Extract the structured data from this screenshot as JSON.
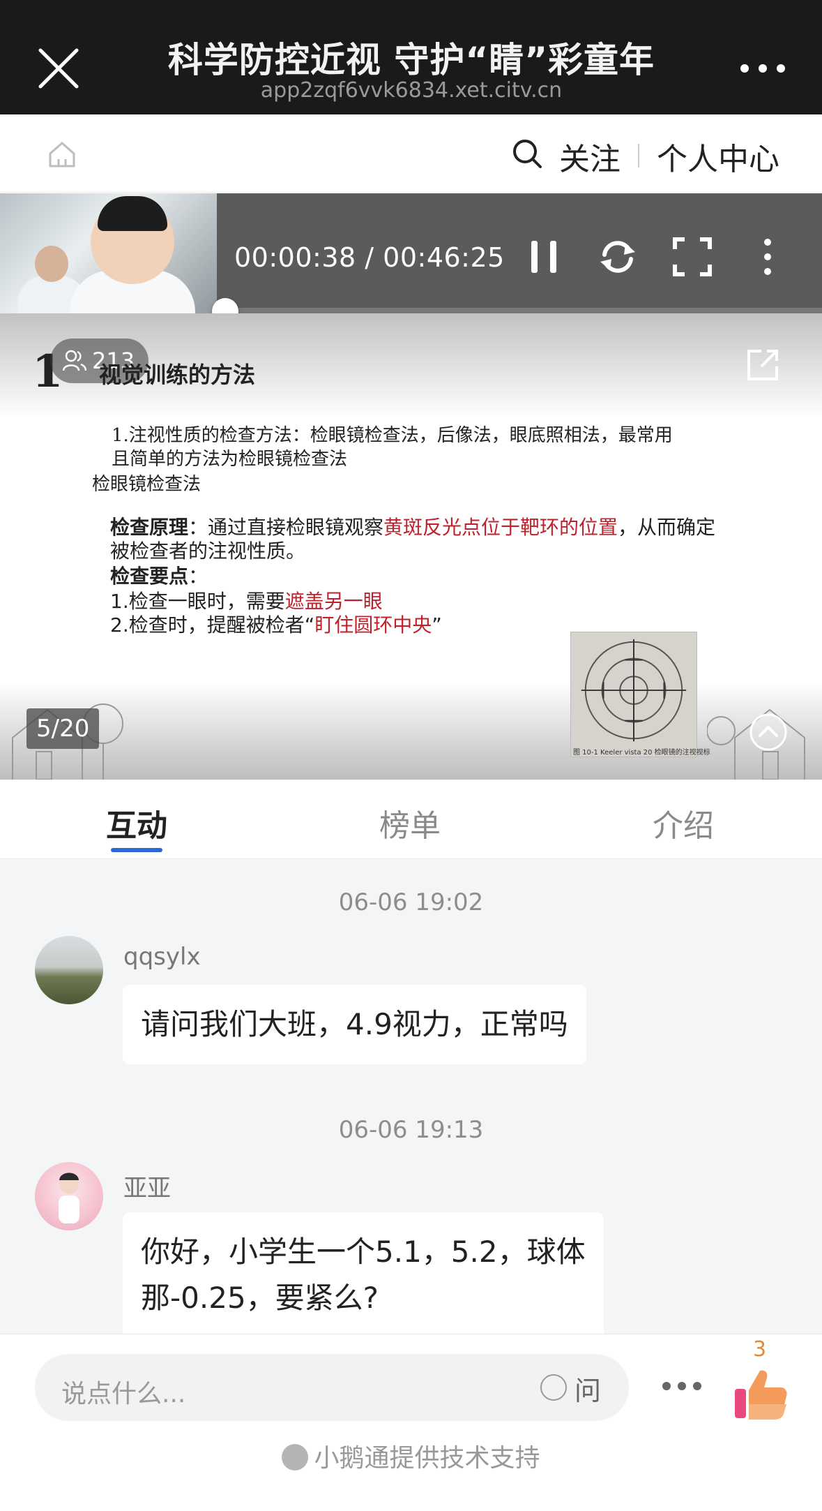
{
  "topbar": {
    "title": "科学防控近视 守护“睛”彩童年",
    "url": "app2zqf6vvk6834.xet.citv.cn"
  },
  "nav": {
    "follow": "关注",
    "personal_center": "个人中心"
  },
  "player": {
    "current_time": "00:00:38",
    "total_time": "00:46:25",
    "time_separator": "/",
    "progress": 0.0137
  },
  "slide": {
    "section_number": "1",
    "viewer_count": "213",
    "heading": "视觉训练的方法",
    "line1": "1.注视性质的检查方法：检眼镜检查法，后像法，眼底照相法，最常用",
    "line2": "且简单的方法为检眼镜检查法",
    "line3": "检眼镜检查法",
    "principle_label": "检查原理",
    "principle_text_a": "：通过直接检眼镜观察",
    "principle_text_red": "黄斑反光点位于靶环的位置",
    "principle_text_b": "，从而确定",
    "principle_text_c": "被检查者的注视性质。",
    "points_label": "检查要点",
    "points_colon": "：",
    "point1_a": "1.检查一眼时，需要",
    "point1_red": "遮盖另一眼",
    "point2_a": "2.检查时，提醒被检者“",
    "point2_red": "盯住圆环中央",
    "point2_b": "”",
    "figure_caption": "图 10-1  Keeler vista 20 检眼镜的注视视标",
    "page_indicator": "5/20"
  },
  "tabs": [
    {
      "label": "互动",
      "active": true
    },
    {
      "label": "榜单",
      "active": false
    },
    {
      "label": "介绍",
      "active": false
    }
  ],
  "chat": {
    "messages": [
      {
        "timestamp": "06-06 19:02",
        "user": "qqsylx",
        "text": "请问我们大班，4.9视力，正常吗"
      },
      {
        "timestamp": "06-06 19:13",
        "user": "亚亚",
        "text_line1": "你好，小学生一个5.1，5.2，球体",
        "text_line2": "那-0.25，要紧么?"
      }
    ]
  },
  "bottom": {
    "input_placeholder": "说点什么...",
    "ask_label": "问",
    "like_count": "3",
    "support_text": "小鹅通提供技术支持"
  },
  "colors": {
    "accent_blue": "#2e67d8",
    "highlight_red": "#c0202a",
    "topbar_bg": "#1a1a1a"
  }
}
